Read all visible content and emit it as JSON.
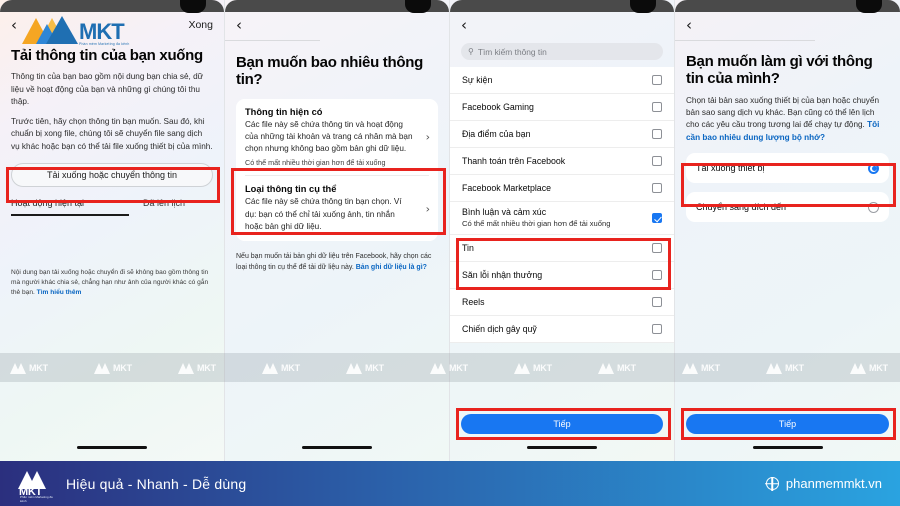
{
  "brand": {
    "logo_text": "MKT",
    "logo_sub": "Phần mềm Marketing đa kênh",
    "slogan": "Hiệu quả - Nhanh  - Dễ dùng",
    "url": "phanmemmkt.vn",
    "globe_icon": "globe-icon",
    "watermark_text": "MKT",
    "accent_blue": "#1877f2",
    "highlight_red": "#e8231e"
  },
  "panel1": {
    "back_icon": "chevron-left-icon",
    "done_label": "Xong",
    "logo_text": "MKT",
    "logo_sub": "Phần mềm Marketing đa kênh",
    "title": "Tải thông tin của bạn xuống",
    "para1": "Thông tin của bạn bao gồm nội dung bạn chia sẻ, dữ liệu về hoạt động của bạn và những gì chúng tôi thu thập.",
    "para2": "Trước tiên, hãy chọn thông tin bạn muốn. Sau đó, khi chuẩn bị xong file, chúng tôi sẽ chuyển file sang dịch vụ khác hoặc bạn có thể tải file xuống thiết bị của mình.",
    "primary_button": "Tải xuống hoặc chuyển thông tin",
    "tabs": [
      {
        "label": "Hoạt động hiện tại",
        "active": true
      },
      {
        "label": "Đã lên lịch",
        "active": false
      }
    ],
    "footnote": "Nội dung bạn tải xuống hoặc chuyển đi sẽ không bao gồm thông tin mà người khác chia sẻ, chẳng hạn như ảnh của người khác có gắn thẻ bạn. ",
    "footnote_link": "Tìm hiểu thêm"
  },
  "panel2": {
    "back_icon": "chevron-left-icon",
    "title": "Bạn muốn bao nhiêu thông tin?",
    "cards": [
      {
        "title": "Thông tin hiện có",
        "desc": "Các file này sẽ chứa thông tin và hoạt động của những tài khoản và trang cá nhân mà bạn chọn nhưng không bao gồm bản ghi dữ liệu.",
        "note": "Có thể mất nhiều thời gian hơn để tải xuống",
        "arrow_icon": "chevron-right-icon"
      },
      {
        "title": "Loại thông tin cụ thể",
        "desc": "Các file này sẽ chứa thông tin bạn chọn. Ví dụ: bạn có thể chỉ tải xuống ảnh, tin nhắn hoặc bản ghi dữ liệu.",
        "note": "",
        "arrow_icon": "chevron-right-icon"
      }
    ],
    "note": "Nếu bạn muốn tải bản ghi dữ liệu trên Facebook, hãy chọn các loại thông tin cụ thể để tải dữ liệu này. ",
    "note_link": "Bản ghi dữ liệu là gì?"
  },
  "panel3": {
    "back_icon": "chevron-left-icon",
    "search_placeholder": "Tìm kiếm thông tin",
    "search_icon": "search-icon",
    "items": [
      {
        "label": "Sự kiện",
        "sub": "",
        "checked": false
      },
      {
        "label": "Facebook Gaming",
        "sub": "",
        "checked": false
      },
      {
        "label": "Địa điểm của bạn",
        "sub": "",
        "checked": false
      },
      {
        "label": "Thanh toán trên Facebook",
        "sub": "",
        "checked": false
      },
      {
        "label": "Facebook Marketplace",
        "sub": "",
        "checked": false
      },
      {
        "label": "Bình luận và cảm xúc",
        "sub": "Có thể mất nhiều thời gian hơn để tải xuống",
        "checked": true
      },
      {
        "label": "Tin",
        "sub": "",
        "checked": false
      },
      {
        "label": "Săn lỗi nhận thưởng",
        "sub": "",
        "checked": false
      },
      {
        "label": "Reels",
        "sub": "",
        "checked": false
      },
      {
        "label": "Chiến dịch gây quỹ",
        "sub": "",
        "checked": false
      }
    ],
    "next_button": "Tiếp"
  },
  "panel4": {
    "back_icon": "chevron-left-icon",
    "title": "Bạn muốn làm gì với thông tin của mình?",
    "para": "Chọn tải bản sao xuống thiết bị của bạn hoặc chuyển bản sao sang dịch vụ khác. Bạn cũng có thể lên lịch cho các yêu cầu trong tương lai để chạy tự động. ",
    "para_link": "Tôi cần bao nhiêu dung lượng bộ nhớ?",
    "options": [
      {
        "label": "Tải xuống thiết bị",
        "selected": true
      },
      {
        "label": "Chuyển sang đích đến",
        "selected": false
      }
    ],
    "next_button": "Tiếp"
  }
}
